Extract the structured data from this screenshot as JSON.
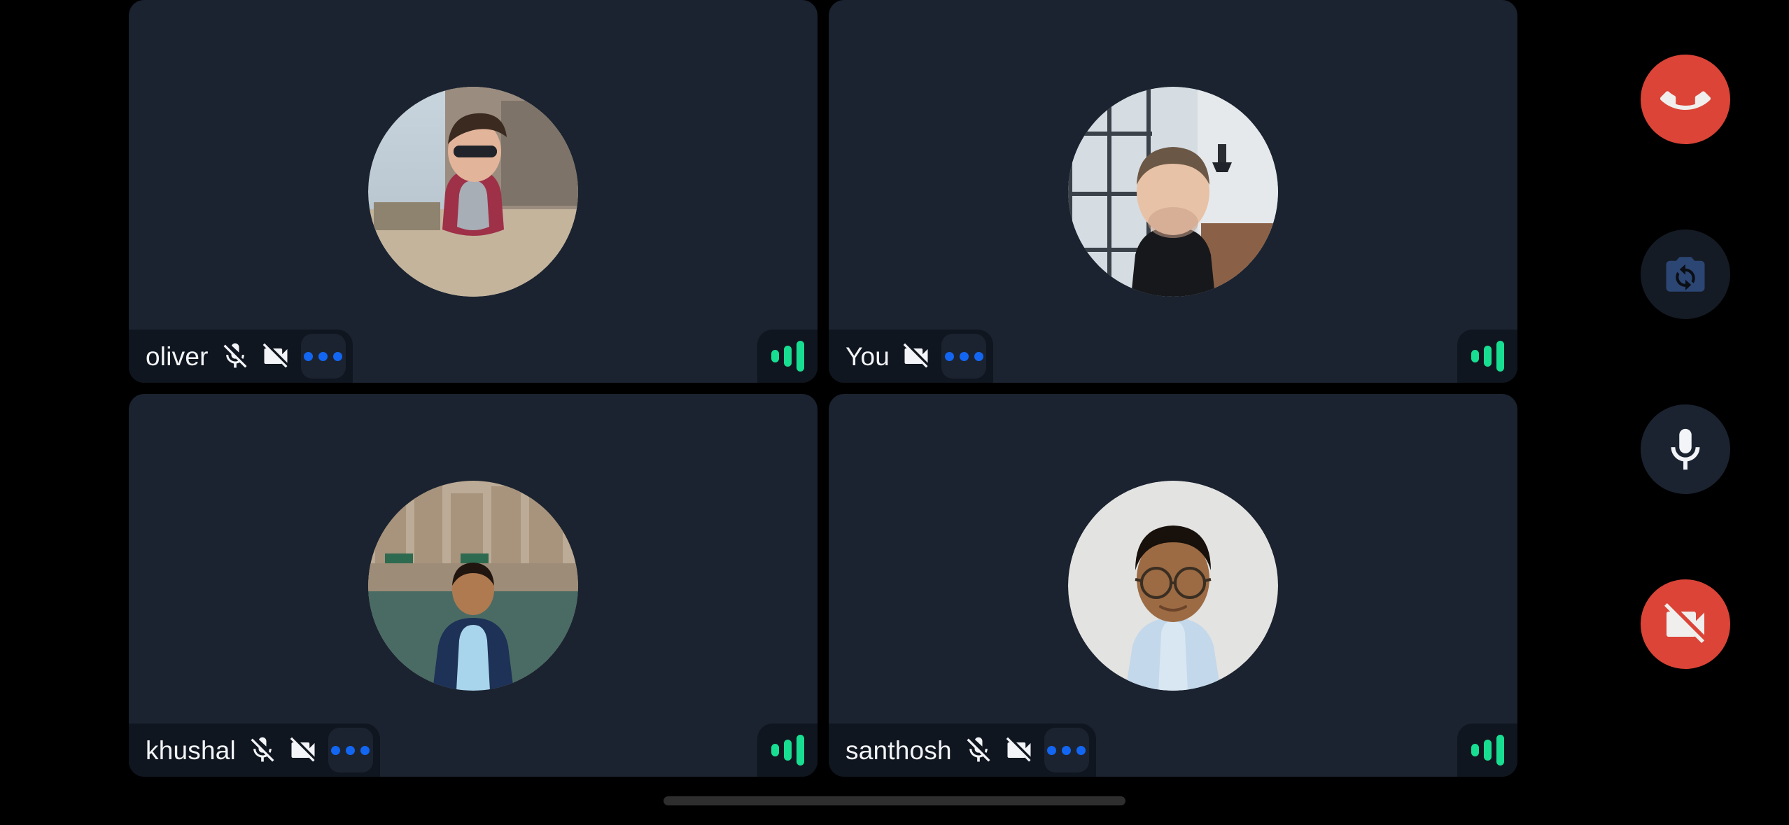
{
  "app": {
    "title": "Video Call",
    "layout": "2x2-grid"
  },
  "colors": {
    "page_background": "#000000",
    "tile_background": "#1B2330",
    "pill_background": "#10161F",
    "accent_blue": "#1266F1",
    "signal_green": "#18DE92",
    "danger_red": "#DB4437",
    "mic_button_background": "#1B2330",
    "flip_button_background": "#151B24",
    "text_primary": "#F2F4F7",
    "home_indicator": "#2E2E2E"
  },
  "grid": {
    "tiles": [
      {
        "id": "tile-oliver",
        "name": "oliver",
        "self": false,
        "mic_muted": true,
        "camera_off": true,
        "mic_icon": "mic-off-icon",
        "camera_icon": "videocam-off-icon",
        "more_icon": "more-options-icon",
        "signal_icon": "signal-strength-icon",
        "signal_bars": 3,
        "avatar_icon": "avatar-photo",
        "avatar_alt": "oliver avatar photo"
      },
      {
        "id": "tile-you",
        "name": "You",
        "self": true,
        "mic_muted": false,
        "camera_off": true,
        "mic_icon": null,
        "camera_icon": "videocam-off-icon",
        "more_icon": "more-options-icon",
        "signal_icon": "signal-strength-icon",
        "signal_bars": 3,
        "avatar_icon": "avatar-photo",
        "avatar_alt": "your avatar photo"
      },
      {
        "id": "tile-khushal",
        "name": "khushal",
        "self": false,
        "mic_muted": true,
        "camera_off": true,
        "mic_icon": "mic-off-icon",
        "camera_icon": "videocam-off-icon",
        "more_icon": "more-options-icon",
        "signal_icon": "signal-strength-icon",
        "signal_bars": 3,
        "avatar_icon": "avatar-photo",
        "avatar_alt": "khushal avatar photo"
      },
      {
        "id": "tile-santhosh",
        "name": "santhosh",
        "self": false,
        "mic_muted": true,
        "camera_off": true,
        "mic_icon": "mic-off-icon",
        "camera_icon": "videocam-off-icon",
        "more_icon": "more-options-icon",
        "signal_icon": "signal-strength-icon",
        "signal_bars": 3,
        "avatar_icon": "avatar-photo",
        "avatar_alt": "santhosh avatar photo"
      }
    ]
  },
  "controls": [
    {
      "id": "end-call",
      "label": "End call",
      "icon": "end-call-icon",
      "state": "active",
      "color": "#DB4437"
    },
    {
      "id": "flip-camera",
      "label": "Switch camera",
      "icon": "flip-camera-icon",
      "state": "disabled",
      "color": "#151B24"
    },
    {
      "id": "microphone",
      "label": "Mute microphone",
      "icon": "mic-icon",
      "state": "on",
      "color": "#1B2330"
    },
    {
      "id": "camera",
      "label": "Turn on camera",
      "icon": "videocam-off-icon",
      "state": "off",
      "color": "#DB4437"
    }
  ],
  "home_indicator": {
    "label": "home-indicator"
  }
}
